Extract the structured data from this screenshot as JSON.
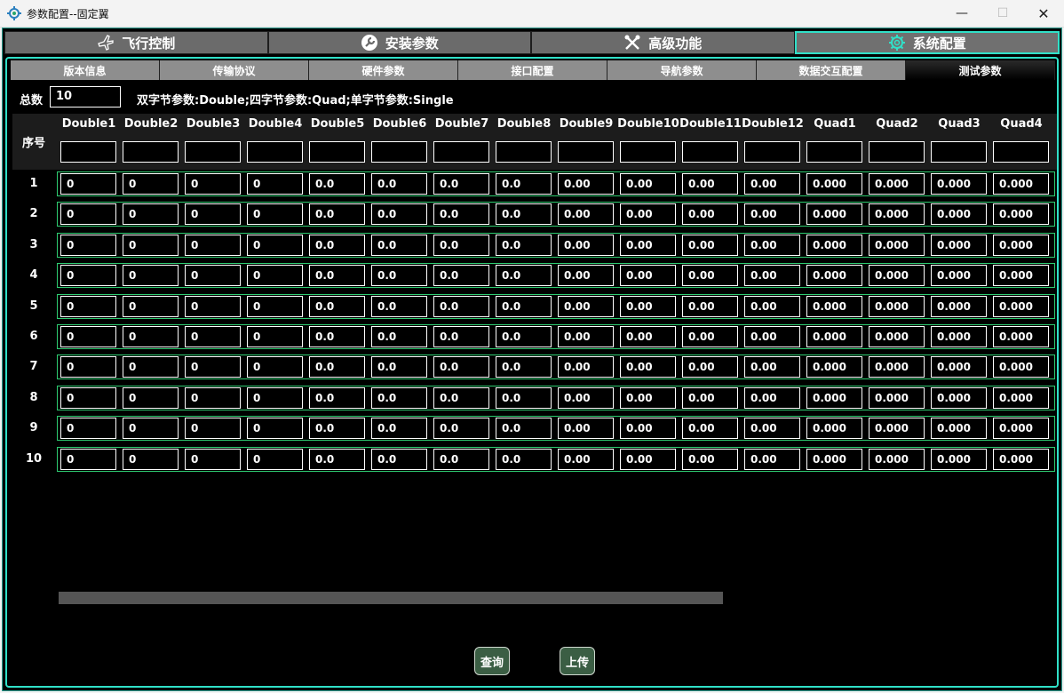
{
  "window": {
    "title": "参数配置--固定翼"
  },
  "top_tabs": [
    {
      "label": "飞行控制",
      "icon": "airplane-icon"
    },
    {
      "label": "安装参数",
      "icon": "wrench-icon"
    },
    {
      "label": "高级功能",
      "icon": "tools-icon"
    },
    {
      "label": "系统配置",
      "icon": "gear-icon",
      "active": true
    }
  ],
  "sub_tabs": [
    {
      "label": "版本信息"
    },
    {
      "label": "传输协议"
    },
    {
      "label": "硬件参数"
    },
    {
      "label": "接口配置"
    },
    {
      "label": "导航参数"
    },
    {
      "label": "数据交互配置"
    },
    {
      "label": "测试参数",
      "active": true
    }
  ],
  "total": {
    "label": "总数",
    "value": "10"
  },
  "legend": "双字节参数:Double;四字节参数:Quad;单字节参数:Single",
  "table": {
    "seq_header": "序号",
    "columns": [
      "Double1",
      "Double2",
      "Double3",
      "Double4",
      "Double5",
      "Double6",
      "Double7",
      "Double8",
      "Double9",
      "Double10",
      "Double11",
      "Double12",
      "Quad1",
      "Quad2",
      "Quad3",
      "Quad4"
    ],
    "rows": [
      {
        "index": "1",
        "values": [
          "0",
          "0",
          "0",
          "0",
          "0.0",
          "0.0",
          "0.0",
          "0.0",
          "0.00",
          "0.00",
          "0.00",
          "0.00",
          "0.000",
          "0.000",
          "0.000",
          "0.000"
        ]
      },
      {
        "index": "2",
        "values": [
          "0",
          "0",
          "0",
          "0",
          "0.0",
          "0.0",
          "0.0",
          "0.0",
          "0.00",
          "0.00",
          "0.00",
          "0.00",
          "0.000",
          "0.000",
          "0.000",
          "0.000"
        ]
      },
      {
        "index": "3",
        "values": [
          "0",
          "0",
          "0",
          "0",
          "0.0",
          "0.0",
          "0.0",
          "0.0",
          "0.00",
          "0.00",
          "0.00",
          "0.00",
          "0.000",
          "0.000",
          "0.000",
          "0.000"
        ]
      },
      {
        "index": "4",
        "values": [
          "0",
          "0",
          "0",
          "0",
          "0.0",
          "0.0",
          "0.0",
          "0.0",
          "0.00",
          "0.00",
          "0.00",
          "0.00",
          "0.000",
          "0.000",
          "0.000",
          "0.000"
        ]
      },
      {
        "index": "5",
        "values": [
          "0",
          "0",
          "0",
          "0",
          "0.0",
          "0.0",
          "0.0",
          "0.0",
          "0.00",
          "0.00",
          "0.00",
          "0.00",
          "0.000",
          "0.000",
          "0.000",
          "0.000"
        ]
      },
      {
        "index": "6",
        "values": [
          "0",
          "0",
          "0",
          "0",
          "0.0",
          "0.0",
          "0.0",
          "0.0",
          "0.00",
          "0.00",
          "0.00",
          "0.00",
          "0.000",
          "0.000",
          "0.000",
          "0.000"
        ]
      },
      {
        "index": "7",
        "values": [
          "0",
          "0",
          "0",
          "0",
          "0.0",
          "0.0",
          "0.0",
          "0.0",
          "0.00",
          "0.00",
          "0.00",
          "0.00",
          "0.000",
          "0.000",
          "0.000",
          "0.000"
        ]
      },
      {
        "index": "8",
        "values": [
          "0",
          "0",
          "0",
          "0",
          "0.0",
          "0.0",
          "0.0",
          "0.0",
          "0.00",
          "0.00",
          "0.00",
          "0.00",
          "0.000",
          "0.000",
          "0.000",
          "0.000"
        ]
      },
      {
        "index": "9",
        "values": [
          "0",
          "0",
          "0",
          "0",
          "0.0",
          "0.0",
          "0.0",
          "0.0",
          "0.00",
          "0.00",
          "0.00",
          "0.00",
          "0.000",
          "0.000",
          "0.000",
          "0.000"
        ]
      },
      {
        "index": "10",
        "values": [
          "0",
          "0",
          "0",
          "0",
          "0.0",
          "0.0",
          "0.0",
          "0.0",
          "0.00",
          "0.00",
          "0.00",
          "0.00",
          "0.000",
          "0.000",
          "0.000",
          "0.000"
        ]
      }
    ]
  },
  "buttons": {
    "query": "查询",
    "upload": "上传"
  },
  "colors": {
    "accent": "#30e0c8",
    "row_border": "#2ecc71",
    "button_bg": "#3b5e44"
  }
}
